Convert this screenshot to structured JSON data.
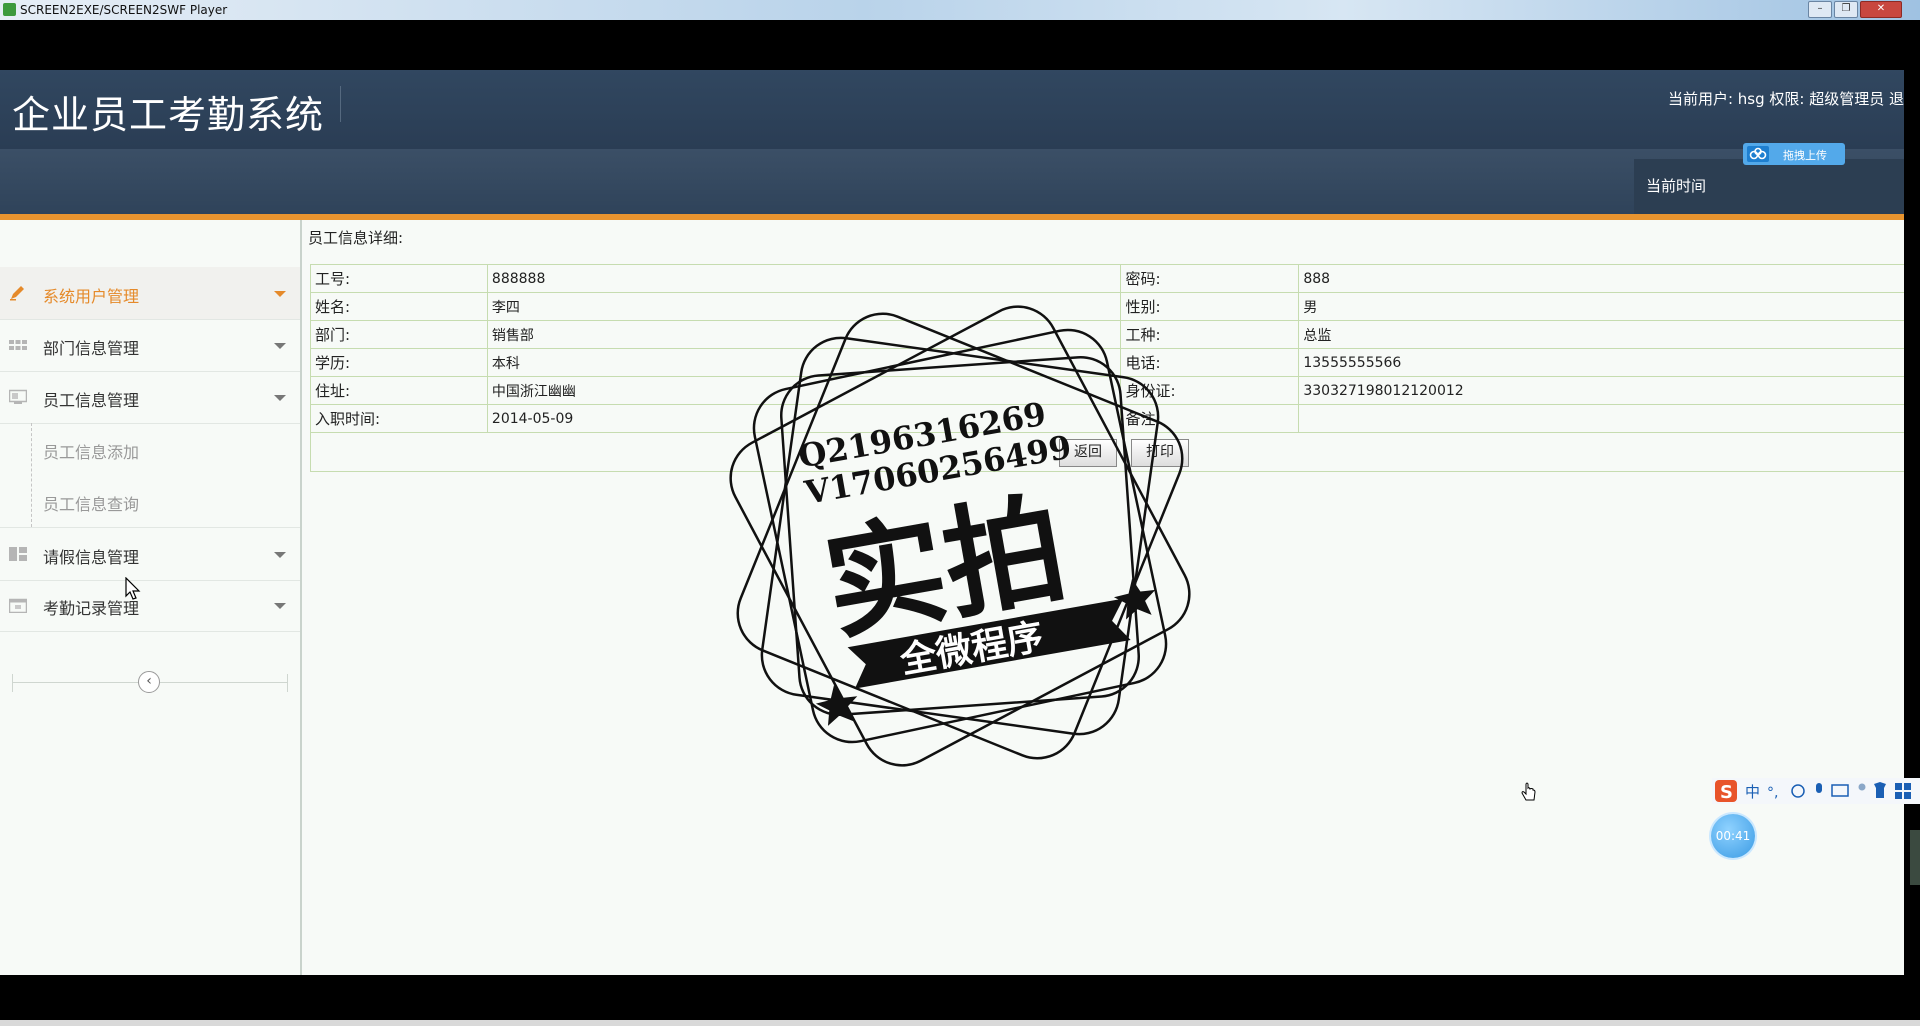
{
  "player": {
    "title": "SCREEN2EXE/SCREEN2SWF Player"
  },
  "header": {
    "app_title": "企业员工考勤系统",
    "user_info": "当前用户: hsg 权限: 超级管理员 退",
    "time_label": "当前时间",
    "upload_label": "拖拽上传"
  },
  "sidebar": {
    "items": [
      {
        "label": "系统用户管理",
        "icon": "pencil-icon",
        "active": true
      },
      {
        "label": "部门信息管理",
        "icon": "grid-icon",
        "active": false
      },
      {
        "label": "员工信息管理",
        "icon": "monitor-icon",
        "active": false
      },
      {
        "label": "请假信息管理",
        "icon": "layout-icon",
        "active": false
      },
      {
        "label": "考勤记录管理",
        "icon": "calendar-icon",
        "active": false
      }
    ],
    "sub_items": [
      "员工信息添加",
      "员工信息查询"
    ],
    "collapse_icon": "chevron-left-icon"
  },
  "content": {
    "title": "员工信息详细:",
    "rows": [
      {
        "k1": "工号:",
        "v1": "888888",
        "k2": "密码:",
        "v2": "888"
      },
      {
        "k1": "姓名:",
        "v1": "李四",
        "k2": "性别:",
        "v2": "男"
      },
      {
        "k1": "部门:",
        "v1": "销售部",
        "k2": "工种:",
        "v2": "总监"
      },
      {
        "k1": "学历:",
        "v1": "本科",
        "k2": "电话:",
        "v2": "13555555566"
      },
      {
        "k1": "住址:",
        "v1": "中国浙江幽幽",
        "k2": "身份证:",
        "v2": "330327198012120012"
      },
      {
        "k1": "入职时间:",
        "v1": "2014-05-09",
        "k2": "备注:",
        "v2": ""
      }
    ],
    "back_button": "返回",
    "print_button": "打印"
  },
  "watermark": {
    "line1": "Q2196316269",
    "line2": "V17060256499",
    "main": "实拍",
    "banner": "全微程序"
  },
  "overlay": {
    "ime_label": "中",
    "timer": "00:41"
  }
}
